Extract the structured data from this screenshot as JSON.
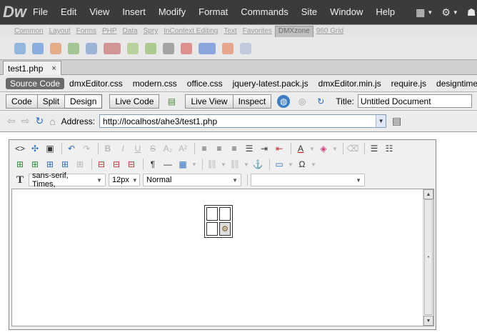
{
  "app": {
    "logo": "Dw",
    "menus": [
      "File",
      "Edit",
      "View",
      "Insert",
      "Modify",
      "Format",
      "Commands",
      "Site",
      "Window",
      "Help"
    ]
  },
  "insert_panel": {
    "tabs": [
      "Common",
      "Layout",
      "Forms",
      "PHP",
      "Data",
      "Spry",
      "InContext Editing",
      "Text",
      "Favorites",
      "DMXzone",
      "960 Grid"
    ],
    "active_tab": "DMXzone"
  },
  "document": {
    "tab_label": "test1.php",
    "close_glyph": "×"
  },
  "related_files": {
    "items": [
      "Source Code",
      "dmxEditor.css",
      "modern.css",
      "office.css",
      "jquery-latest.pack.js",
      "dmxEditor.min.js",
      "require.js",
      "designtime.css"
    ]
  },
  "doc_toolbar": {
    "code": "Code",
    "split": "Split",
    "design": "Design",
    "live_code": "Live Code",
    "live_view": "Live View",
    "inspect": "Inspect",
    "title_label": "Title:",
    "title_value": "Untitled Document"
  },
  "browser_nav": {
    "address_label": "Address:",
    "address_value": "http://localhost/ahe3/test1.php"
  },
  "editor": {
    "font_family": "sans-serif, Times,",
    "font_size": "12px",
    "format": "Normal",
    "style": ""
  },
  "colors": {
    "menubar_bg": "#3b3b3b",
    "accent_blue": "#2d6fbd"
  }
}
